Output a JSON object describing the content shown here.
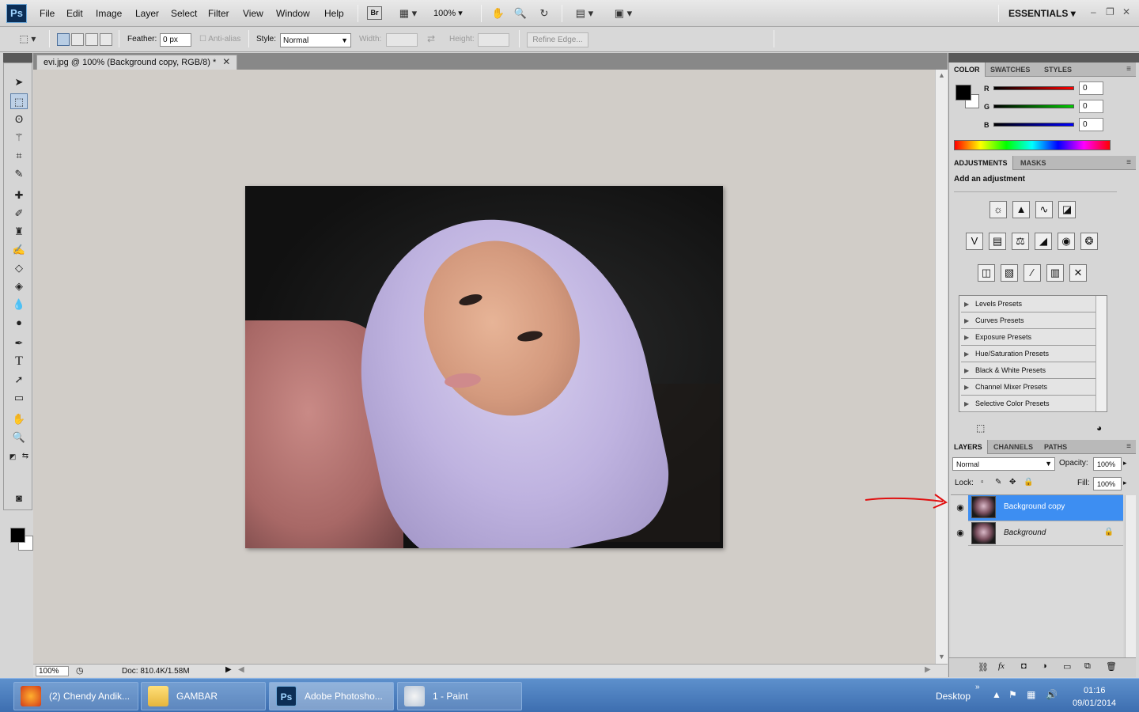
{
  "app": {
    "logo": "Ps",
    "workspace": "ESSENTIALS"
  },
  "menu": [
    "File",
    "Edit",
    "Image",
    "Layer",
    "Select",
    "Filter",
    "View",
    "Window",
    "Help"
  ],
  "menubar_tools": {
    "bridge": "Br",
    "zoom": "100%"
  },
  "options": {
    "feather_label": "Feather:",
    "feather_value": "0 px",
    "antialias_label": "Anti-alias",
    "style_label": "Style:",
    "style_value": "Normal",
    "width_label": "Width:",
    "height_label": "Height:",
    "refine_edge": "Refine Edge..."
  },
  "document": {
    "tab_title": "evi.jpg @ 100% (Background copy, RGB/8) *",
    "zoom_status": "100%",
    "doc_size": "Doc: 810.4K/1.58M"
  },
  "color_panel": {
    "tabs": [
      "COLOR",
      "SWATCHES",
      "STYLES"
    ],
    "channels": [
      {
        "label": "R",
        "value": "0",
        "color": "#e00000"
      },
      {
        "label": "G",
        "value": "0",
        "color": "#00b000"
      },
      {
        "label": "B",
        "value": "0",
        "color": "#0000d0"
      }
    ]
  },
  "adjustments_panel": {
    "tabs": [
      "ADJUSTMENTS",
      "MASKS"
    ],
    "title": "Add an adjustment",
    "presets": [
      "Levels Presets",
      "Curves Presets",
      "Exposure Presets",
      "Hue/Saturation Presets",
      "Black & White Presets",
      "Channel Mixer Presets",
      "Selective Color Presets"
    ]
  },
  "layers_panel": {
    "tabs": [
      "LAYERS",
      "CHANNELS",
      "PATHS"
    ],
    "blend_mode": "Normal",
    "opacity_label": "Opacity:",
    "opacity_value": "100%",
    "lock_label": "Lock:",
    "fill_label": "Fill:",
    "fill_value": "100%",
    "layers": [
      {
        "name": "Background copy",
        "selected": true
      },
      {
        "name": "Background",
        "selected": false
      }
    ]
  },
  "taskbar": {
    "tasks": [
      {
        "label": "(2) Chendy Andik...",
        "icon": "firefox-icon"
      },
      {
        "label": "GAMBAR",
        "icon": "folder-icon"
      },
      {
        "label": "Adobe Photosho...",
        "icon": "photoshop-icon"
      },
      {
        "label": "1 - Paint",
        "icon": "paint-icon"
      }
    ],
    "desktop_label": "Desktop",
    "time": "01:16",
    "date": "09/01/2014"
  },
  "colors": {
    "accent": "#3d8ef2",
    "taskbar": "#4a7ec0",
    "canvas_bg": "#d1cdc8",
    "annotation": "#e01010"
  }
}
